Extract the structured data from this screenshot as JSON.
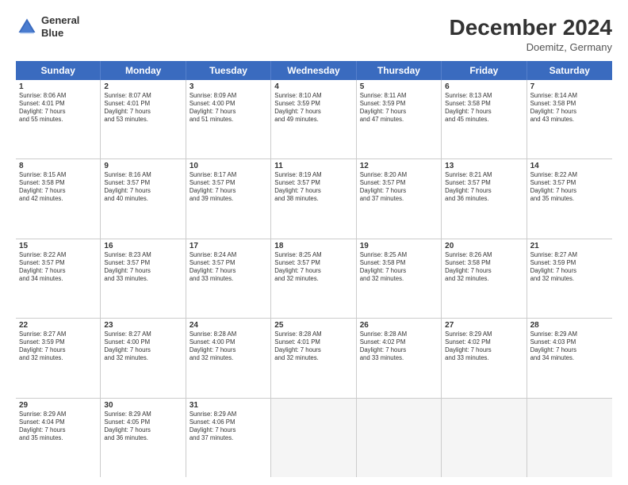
{
  "header": {
    "logo_line1": "General",
    "logo_line2": "Blue",
    "title": "December 2024",
    "subtitle": "Doemitz, Germany"
  },
  "days": [
    "Sunday",
    "Monday",
    "Tuesday",
    "Wednesday",
    "Thursday",
    "Friday",
    "Saturday"
  ],
  "weeks": [
    [
      {
        "day": "1",
        "lines": [
          "Sunrise: 8:06 AM",
          "Sunset: 4:01 PM",
          "Daylight: 7 hours",
          "and 55 minutes."
        ]
      },
      {
        "day": "2",
        "lines": [
          "Sunrise: 8:07 AM",
          "Sunset: 4:01 PM",
          "Daylight: 7 hours",
          "and 53 minutes."
        ]
      },
      {
        "day": "3",
        "lines": [
          "Sunrise: 8:09 AM",
          "Sunset: 4:00 PM",
          "Daylight: 7 hours",
          "and 51 minutes."
        ]
      },
      {
        "day": "4",
        "lines": [
          "Sunrise: 8:10 AM",
          "Sunset: 3:59 PM",
          "Daylight: 7 hours",
          "and 49 minutes."
        ]
      },
      {
        "day": "5",
        "lines": [
          "Sunrise: 8:11 AM",
          "Sunset: 3:59 PM",
          "Daylight: 7 hours",
          "and 47 minutes."
        ]
      },
      {
        "day": "6",
        "lines": [
          "Sunrise: 8:13 AM",
          "Sunset: 3:58 PM",
          "Daylight: 7 hours",
          "and 45 minutes."
        ]
      },
      {
        "day": "7",
        "lines": [
          "Sunrise: 8:14 AM",
          "Sunset: 3:58 PM",
          "Daylight: 7 hours",
          "and 43 minutes."
        ]
      }
    ],
    [
      {
        "day": "8",
        "lines": [
          "Sunrise: 8:15 AM",
          "Sunset: 3:58 PM",
          "Daylight: 7 hours",
          "and 42 minutes."
        ]
      },
      {
        "day": "9",
        "lines": [
          "Sunrise: 8:16 AM",
          "Sunset: 3:57 PM",
          "Daylight: 7 hours",
          "and 40 minutes."
        ]
      },
      {
        "day": "10",
        "lines": [
          "Sunrise: 8:17 AM",
          "Sunset: 3:57 PM",
          "Daylight: 7 hours",
          "and 39 minutes."
        ]
      },
      {
        "day": "11",
        "lines": [
          "Sunrise: 8:19 AM",
          "Sunset: 3:57 PM",
          "Daylight: 7 hours",
          "and 38 minutes."
        ]
      },
      {
        "day": "12",
        "lines": [
          "Sunrise: 8:20 AM",
          "Sunset: 3:57 PM",
          "Daylight: 7 hours",
          "and 37 minutes."
        ]
      },
      {
        "day": "13",
        "lines": [
          "Sunrise: 8:21 AM",
          "Sunset: 3:57 PM",
          "Daylight: 7 hours",
          "and 36 minutes."
        ]
      },
      {
        "day": "14",
        "lines": [
          "Sunrise: 8:22 AM",
          "Sunset: 3:57 PM",
          "Daylight: 7 hours",
          "and 35 minutes."
        ]
      }
    ],
    [
      {
        "day": "15",
        "lines": [
          "Sunrise: 8:22 AM",
          "Sunset: 3:57 PM",
          "Daylight: 7 hours",
          "and 34 minutes."
        ]
      },
      {
        "day": "16",
        "lines": [
          "Sunrise: 8:23 AM",
          "Sunset: 3:57 PM",
          "Daylight: 7 hours",
          "and 33 minutes."
        ]
      },
      {
        "day": "17",
        "lines": [
          "Sunrise: 8:24 AM",
          "Sunset: 3:57 PM",
          "Daylight: 7 hours",
          "and 33 minutes."
        ]
      },
      {
        "day": "18",
        "lines": [
          "Sunrise: 8:25 AM",
          "Sunset: 3:57 PM",
          "Daylight: 7 hours",
          "and 32 minutes."
        ]
      },
      {
        "day": "19",
        "lines": [
          "Sunrise: 8:25 AM",
          "Sunset: 3:58 PM",
          "Daylight: 7 hours",
          "and 32 minutes."
        ]
      },
      {
        "day": "20",
        "lines": [
          "Sunrise: 8:26 AM",
          "Sunset: 3:58 PM",
          "Daylight: 7 hours",
          "and 32 minutes."
        ]
      },
      {
        "day": "21",
        "lines": [
          "Sunrise: 8:27 AM",
          "Sunset: 3:59 PM",
          "Daylight: 7 hours",
          "and 32 minutes."
        ]
      }
    ],
    [
      {
        "day": "22",
        "lines": [
          "Sunrise: 8:27 AM",
          "Sunset: 3:59 PM",
          "Daylight: 7 hours",
          "and 32 minutes."
        ]
      },
      {
        "day": "23",
        "lines": [
          "Sunrise: 8:27 AM",
          "Sunset: 4:00 PM",
          "Daylight: 7 hours",
          "and 32 minutes."
        ]
      },
      {
        "day": "24",
        "lines": [
          "Sunrise: 8:28 AM",
          "Sunset: 4:00 PM",
          "Daylight: 7 hours",
          "and 32 minutes."
        ]
      },
      {
        "day": "25",
        "lines": [
          "Sunrise: 8:28 AM",
          "Sunset: 4:01 PM",
          "Daylight: 7 hours",
          "and 32 minutes."
        ]
      },
      {
        "day": "26",
        "lines": [
          "Sunrise: 8:28 AM",
          "Sunset: 4:02 PM",
          "Daylight: 7 hours",
          "and 33 minutes."
        ]
      },
      {
        "day": "27",
        "lines": [
          "Sunrise: 8:29 AM",
          "Sunset: 4:02 PM",
          "Daylight: 7 hours",
          "and 33 minutes."
        ]
      },
      {
        "day": "28",
        "lines": [
          "Sunrise: 8:29 AM",
          "Sunset: 4:03 PM",
          "Daylight: 7 hours",
          "and 34 minutes."
        ]
      }
    ],
    [
      {
        "day": "29",
        "lines": [
          "Sunrise: 8:29 AM",
          "Sunset: 4:04 PM",
          "Daylight: 7 hours",
          "and 35 minutes."
        ]
      },
      {
        "day": "30",
        "lines": [
          "Sunrise: 8:29 AM",
          "Sunset: 4:05 PM",
          "Daylight: 7 hours",
          "and 36 minutes."
        ]
      },
      {
        "day": "31",
        "lines": [
          "Sunrise: 8:29 AM",
          "Sunset: 4:06 PM",
          "Daylight: 7 hours",
          "and 37 minutes."
        ]
      },
      null,
      null,
      null,
      null
    ]
  ]
}
